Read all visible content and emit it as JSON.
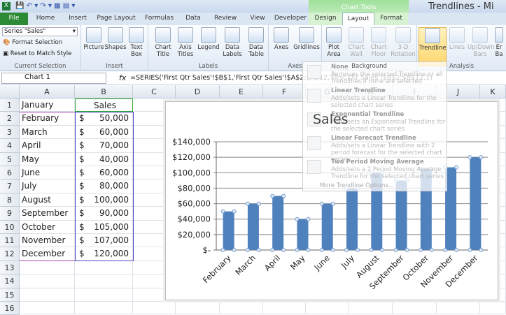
{
  "window": {
    "title": "Trendlines - Mi",
    "context_tab": "Chart Tools"
  },
  "tabs": [
    "File",
    "Home",
    "Insert",
    "Page Layout",
    "Formulas",
    "Data",
    "Review",
    "View",
    "Developer",
    "Design",
    "Layout",
    "Format"
  ],
  "active_tab": "Layout",
  "ribbon": {
    "current_selection": {
      "dropdown": "Series \"Sales\"",
      "format_selection": "Format Selection",
      "reset": "Reset to Match Style",
      "label": "Current Selection"
    },
    "insert": {
      "buttons": [
        "Picture",
        "Shapes",
        "Text Box"
      ],
      "label": "Insert"
    },
    "labels": {
      "buttons": [
        "Chart Title",
        "Axis Titles",
        "Legend",
        "Data Labels",
        "Data Table"
      ],
      "label": "Labels"
    },
    "axes": {
      "buttons": [
        "Axes",
        "Gridlines"
      ],
      "label": "Axes"
    },
    "background": {
      "buttons": [
        "Plot Area",
        "Chart Wall",
        "Chart Floor",
        "3-D Rotation"
      ],
      "label": "Background"
    },
    "analysis": {
      "buttons": [
        "Trendline",
        "Lines",
        "Up/Down Bars",
        "Er Ba"
      ],
      "label": "Analysis"
    }
  },
  "formula_bar": {
    "name_box": "Chart 1",
    "fx": "fx",
    "formula": "=SERIES('First Qtr Sales'!$B$1,'First Qtr Sales'!$A$2:$A$12,'First Qtr Sales'!$B$2:$B$12,1)"
  },
  "columns": [
    "A",
    "B",
    "C",
    "D",
    "E",
    "F",
    "G",
    "H",
    "I",
    "J",
    "K"
  ],
  "rows": [
    "1",
    "2",
    "3",
    "4",
    "5",
    "6",
    "7",
    "8",
    "9",
    "10",
    "11",
    "12",
    "13",
    "14",
    "15",
    "16"
  ],
  "sheet": {
    "header": [
      "January",
      "Sales"
    ],
    "data": [
      [
        "February",
        "$",
        "50,000"
      ],
      [
        "March",
        "$",
        "60,000"
      ],
      [
        "April",
        "$",
        "70,000"
      ],
      [
        "May",
        "$",
        "40,000"
      ],
      [
        "June",
        "$",
        "60,000"
      ],
      [
        "July",
        "$",
        "80,000"
      ],
      [
        "August",
        "$",
        "100,000"
      ],
      [
        "September",
        "$",
        "90,000"
      ],
      [
        "October",
        "$",
        "105,000"
      ],
      [
        "November",
        "$",
        "107,000"
      ],
      [
        "December",
        "$",
        "120,000"
      ]
    ]
  },
  "chart_data": {
    "type": "bar",
    "title": "Sales",
    "categories": [
      "February",
      "March",
      "April",
      "May",
      "June",
      "July",
      "August",
      "September",
      "October",
      "November",
      "December"
    ],
    "series": [
      {
        "name": "Sales",
        "values": [
          50000,
          60000,
          70000,
          40000,
          60000,
          80000,
          100000,
          90000,
          105000,
          107000,
          120000
        ]
      }
    ],
    "ylim": [
      0,
      140000
    ],
    "yticks": [
      "$-",
      "$20,000",
      "$40,000",
      "$60,000",
      "$80,000",
      "$100,000",
      "$120,000",
      "$140,000"
    ],
    "grid": true,
    "bar_color": "#4f81bd"
  },
  "trendline_menu": [
    {
      "title": "None",
      "desc": "Removes the selected Trendline or all Trendlines if none are selected"
    },
    {
      "title": "Linear Trendline",
      "desc": "Adds/sets a Linear Trendline for the selected chart series"
    },
    {
      "title": "Exponential Trendline",
      "desc": "Adds/sets an Exponential Trendline for the selected chart series"
    },
    {
      "title": "Linear Forecast Trendline",
      "desc": "Adds/sets a Linear Trendline with 2 period forecast for the selected chart series"
    },
    {
      "title": "Two Period Moving Average",
      "desc": "Adds/sets a 2 Period Moving Average Trendline for the selected chart series"
    }
  ],
  "trendline_more": "More Trendline Options..."
}
